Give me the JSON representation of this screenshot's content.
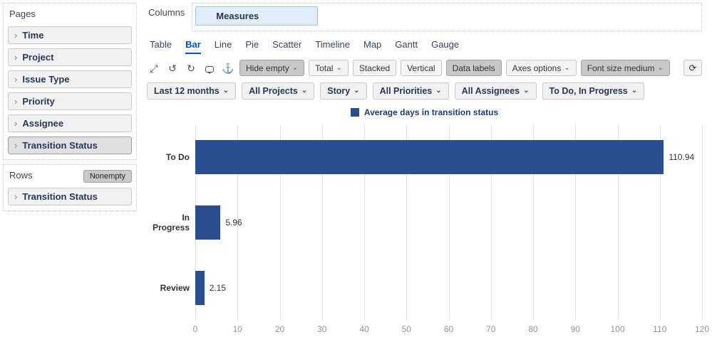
{
  "sidebar": {
    "pages_label": "Pages",
    "pages": [
      {
        "label": "Time",
        "selected": false
      },
      {
        "label": "Project",
        "selected": false
      },
      {
        "label": "Issue Type",
        "selected": false
      },
      {
        "label": "Priority",
        "selected": false
      },
      {
        "label": "Assignee",
        "selected": false
      },
      {
        "label": "Transition Status",
        "selected": true
      }
    ],
    "rows_label": "Rows",
    "nonempty_button": "Nonempty",
    "rows": [
      {
        "label": "Transition Status"
      }
    ]
  },
  "columns": {
    "label": "Columns",
    "measure_chip": "Measures"
  },
  "tabs": [
    {
      "label": "Table",
      "active": false
    },
    {
      "label": "Bar",
      "active": true
    },
    {
      "label": "Line",
      "active": false
    },
    {
      "label": "Pie",
      "active": false
    },
    {
      "label": "Scatter",
      "active": false
    },
    {
      "label": "Timeline",
      "active": false
    },
    {
      "label": "Map",
      "active": false
    },
    {
      "label": "Gantt",
      "active": false
    },
    {
      "label": "Gauge",
      "active": false
    }
  ],
  "toolbar": {
    "icons": [
      "expand-icon",
      "undo-icon",
      "redo-icon",
      "comment-icon",
      "anchor-icon",
      "refresh-icon"
    ],
    "buttons": [
      {
        "label": "Hide empty",
        "caret": true,
        "active": true
      },
      {
        "label": "Total",
        "caret": true,
        "active": false
      },
      {
        "label": "Stacked",
        "caret": false,
        "active": false
      },
      {
        "label": "Vertical",
        "caret": false,
        "active": false
      },
      {
        "label": "Data labels",
        "caret": false,
        "active": true
      },
      {
        "label": "Axes options",
        "caret": true,
        "active": false
      },
      {
        "label": "Font size medium",
        "caret": true,
        "active": true
      }
    ]
  },
  "filters": [
    "Last 12 months",
    "All Projects",
    "Story",
    "All Priorities",
    "All Assignees",
    "To Do, In Progress"
  ],
  "legend": {
    "label": "Average days in transition status",
    "color": "#2a4d8f"
  },
  "chart_data": {
    "type": "bar",
    "orientation": "horizontal",
    "title": "",
    "categories": [
      "To Do",
      "In Progress",
      "Review"
    ],
    "values": [
      110.94,
      5.96,
      2.15
    ],
    "series_name": "Average days in transition status",
    "xlim": [
      0,
      120
    ],
    "xticks": [
      0,
      10,
      20,
      30,
      40,
      50,
      60,
      70,
      80,
      90,
      100,
      110,
      120
    ],
    "bar_color": "#2a4d8f",
    "grid": true,
    "legend_position": "top"
  }
}
